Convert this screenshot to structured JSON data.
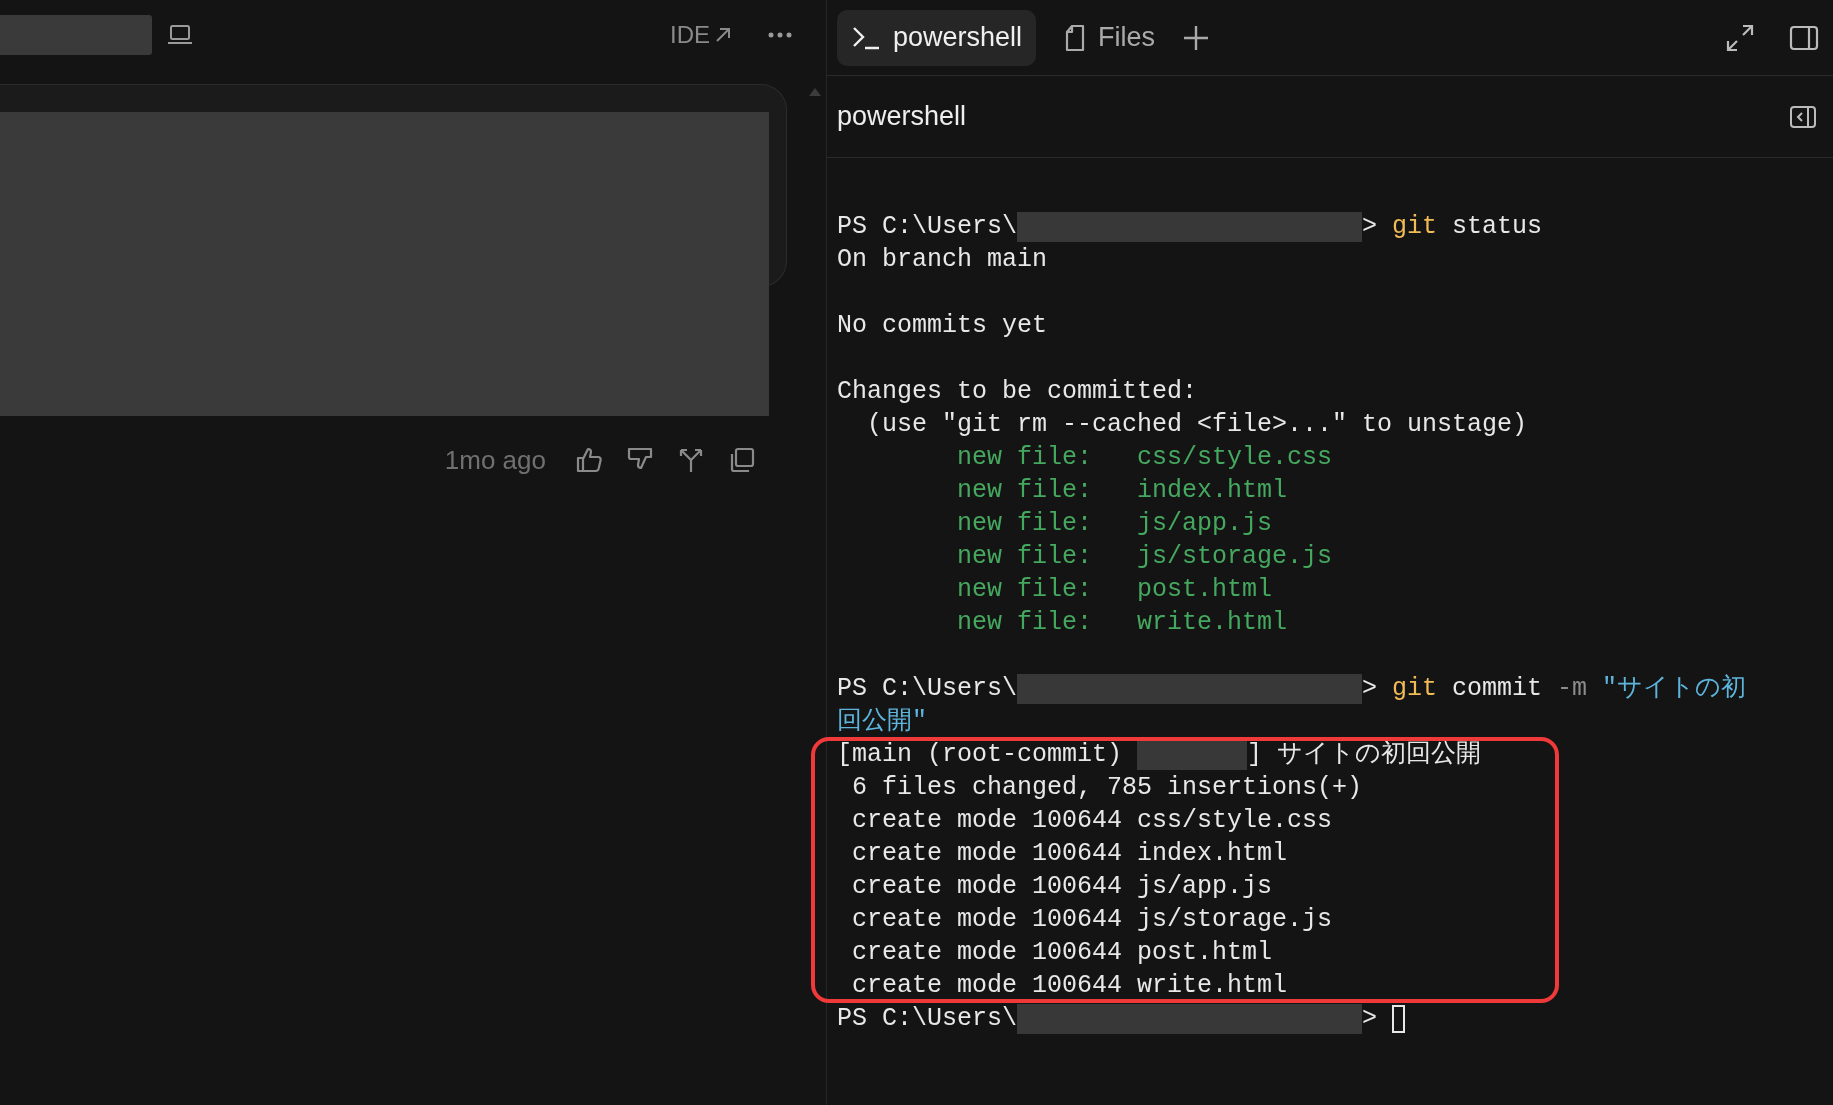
{
  "left_panel": {
    "toolbar": {
      "ide_link": "IDE"
    },
    "message": {
      "time": "1mo ago"
    }
  },
  "terminal": {
    "tabs": [
      {
        "label": "powershell",
        "kind": "terminal",
        "selected": true
      },
      {
        "label": "Files",
        "kind": "files",
        "selected": false
      }
    ],
    "title": "powershell",
    "lines": [
      {
        "segments": [
          {
            "text": "PS C:\\Users\\",
            "kind": "plain"
          },
          {
            "kind": "redacted-path"
          },
          {
            "text": "> ",
            "kind": "plain"
          },
          {
            "text": "git",
            "kind": "command"
          },
          {
            "text": " status",
            "kind": "plain"
          }
        ]
      },
      {
        "segments": [
          {
            "text": "On branch main",
            "kind": "plain"
          }
        ]
      },
      {
        "blank_before": true,
        "segments": [
          {
            "text": "No commits yet",
            "kind": "plain"
          }
        ]
      },
      {
        "blank_before": true,
        "segments": [
          {
            "text": "Changes to be committed:",
            "kind": "plain"
          }
        ]
      },
      {
        "segments": [
          {
            "text": "  (use \"git rm --cached <file>...\" to unstage)",
            "kind": "plain"
          }
        ]
      },
      {
        "segments": [
          {
            "text": "        new file:   css/style.css",
            "kind": "added"
          }
        ]
      },
      {
        "segments": [
          {
            "text": "        new file:   index.html",
            "kind": "added"
          }
        ]
      },
      {
        "segments": [
          {
            "text": "        new file:   js/app.js",
            "kind": "added"
          }
        ]
      },
      {
        "segments": [
          {
            "text": "        new file:   js/storage.js",
            "kind": "added"
          }
        ]
      },
      {
        "segments": [
          {
            "text": "        new file:   post.html",
            "kind": "added"
          }
        ]
      },
      {
        "segments": [
          {
            "text": "        new file:   write.html",
            "kind": "added"
          }
        ]
      },
      {
        "blank_before": true,
        "segments": [
          {
            "text": "PS C:\\Users\\",
            "kind": "plain"
          },
          {
            "kind": "redacted-path"
          },
          {
            "text": "> ",
            "kind": "plain"
          },
          {
            "text": "git",
            "kind": "command"
          },
          {
            "text": " commit ",
            "kind": "plain"
          },
          {
            "text": "-m",
            "kind": "flag"
          },
          {
            "text": " \"サイトの初",
            "kind": "string"
          }
        ]
      },
      {
        "segments": [
          {
            "text": "回公開\"",
            "kind": "string"
          }
        ]
      },
      {
        "segments": [
          {
            "text": "[main (root-commit) ",
            "kind": "plain"
          },
          {
            "kind": "redacted-hash"
          },
          {
            "text": "] サイトの初回公開",
            "kind": "plain"
          }
        ]
      },
      {
        "segments": [
          {
            "text": " 6 files changed, 785 insertions(+)",
            "kind": "plain"
          }
        ]
      },
      {
        "segments": [
          {
            "text": " create mode 100644 css/style.css",
            "kind": "plain"
          }
        ]
      },
      {
        "segments": [
          {
            "text": " create mode 100644 index.html",
            "kind": "plain"
          }
        ]
      },
      {
        "segments": [
          {
            "text": " create mode 100644 js/app.js",
            "kind": "plain"
          }
        ]
      },
      {
        "segments": [
          {
            "text": " create mode 100644 js/storage.js",
            "kind": "plain"
          }
        ]
      },
      {
        "segments": [
          {
            "text": " create mode 100644 post.html",
            "kind": "plain"
          }
        ]
      },
      {
        "segments": [
          {
            "text": " create mode 100644 write.html",
            "kind": "plain"
          }
        ]
      },
      {
        "segments": [
          {
            "text": "PS C:\\Users\\",
            "kind": "plain"
          },
          {
            "kind": "redacted-path"
          },
          {
            "text": "> ",
            "kind": "plain"
          },
          {
            "kind": "cursor"
          }
        ]
      }
    ]
  }
}
